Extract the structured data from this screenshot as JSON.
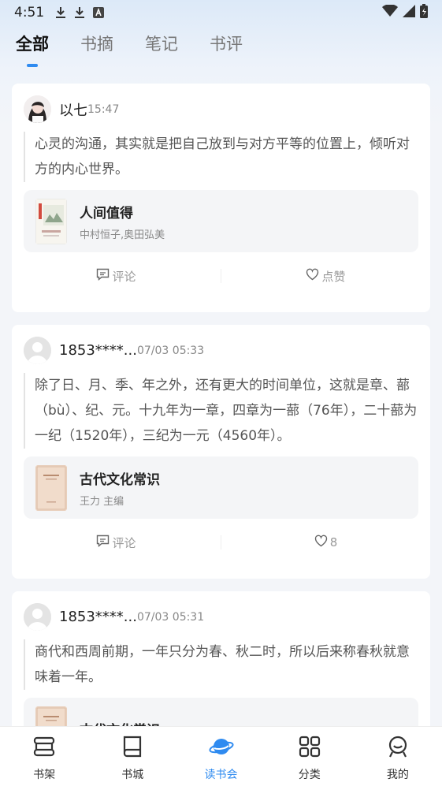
{
  "status_bar": {
    "time": "4:51",
    "left_icons": [
      "download-icon",
      "download-icon",
      "a-icon"
    ],
    "right_icons": [
      "wifi-icon",
      "signal-icon",
      "battery-icon"
    ]
  },
  "tabs": [
    {
      "label": "全部",
      "active": true
    },
    {
      "label": "书摘",
      "active": false
    },
    {
      "label": "笔记",
      "active": false
    },
    {
      "label": "书评",
      "active": false
    }
  ],
  "posts": [
    {
      "user": "以七",
      "time": "15:47",
      "quote": "心灵的沟通，其实就是把自己放到与对方平等的位置上，倾听对方的内心世界。",
      "book_title": "人间值得",
      "book_author": "中村恒子,奥田弘美",
      "comment_label": "评论",
      "like_label": "点赞"
    },
    {
      "user": "1853****...",
      "time": "07/03 05:33",
      "quote": "除了日、月、季、年之外，还有更大的时间单位，这就是章、蔀（bù）、纪、元。十九年为一章，四章为一蔀（76年），二十蔀为一纪（1520年），三纪为一元（4560年）。",
      "book_title": "古代文化常识",
      "book_author": "王力 主编",
      "comment_label": "评论",
      "like_label": "8"
    },
    {
      "user": "1853****...",
      "time": "07/03 05:31",
      "quote": "商代和西周前期，一年只分为春、秋二时，所以后来称春秋就意味着一年。",
      "book_title": "古代文化常识"
    }
  ],
  "bottom_nav": [
    {
      "label": "书架",
      "icon": "bookshelf-icon",
      "active": false
    },
    {
      "label": "书城",
      "icon": "book-icon",
      "active": false
    },
    {
      "label": "读书会",
      "icon": "planet-icon",
      "active": true
    },
    {
      "label": "分类",
      "icon": "grid-icon",
      "active": false
    },
    {
      "label": "我的",
      "icon": "profile-icon",
      "active": false
    }
  ],
  "colors": {
    "accent": "#2f8bf0",
    "background": "#f3f5f9",
    "card": "#ffffff"
  }
}
